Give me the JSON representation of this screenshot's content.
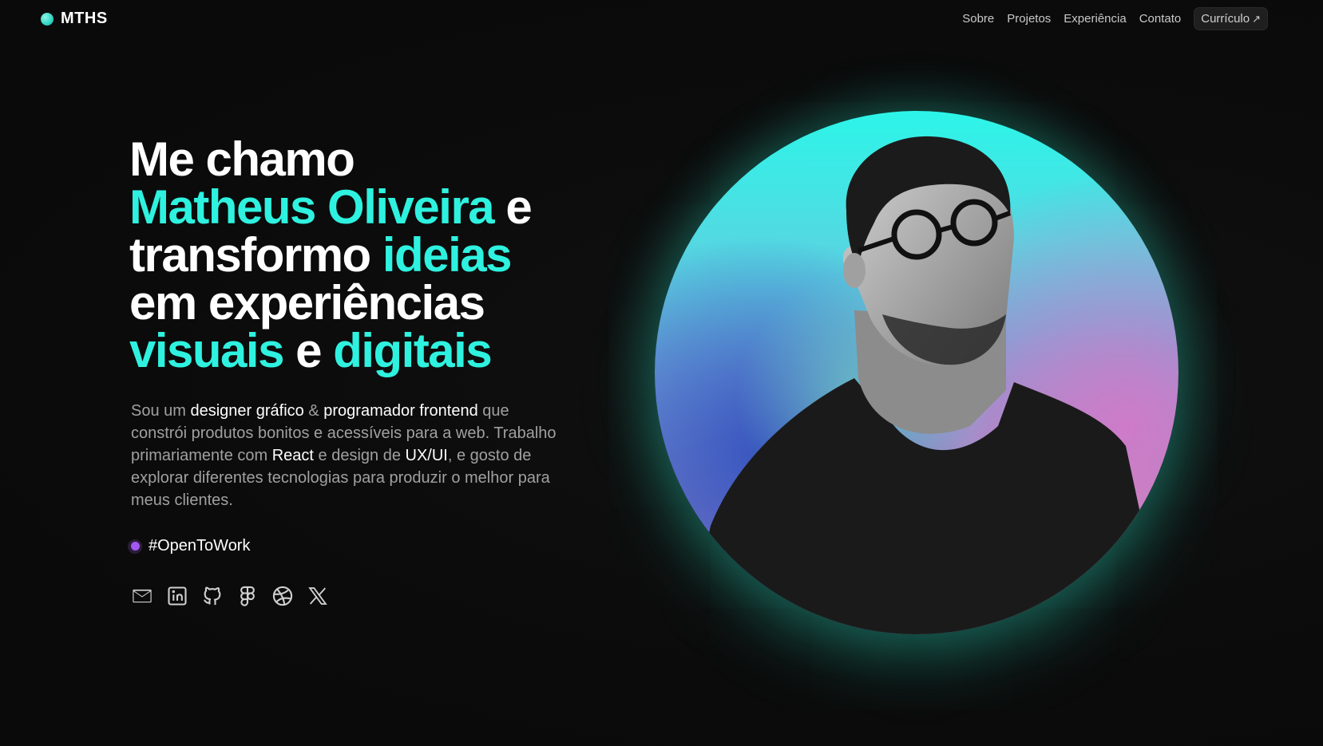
{
  "header": {
    "logo_text": "MTHS",
    "nav": [
      "Sobre",
      "Projetos",
      "Experiência",
      "Contato"
    ],
    "cv_label": "Currículo",
    "cv_icon": "arrow-up-right-icon"
  },
  "hero": {
    "line1": "Me chamo",
    "name": "Matheus Oliveira",
    "e1": "e",
    "transformo": "transformo",
    "ideias": "ideias",
    "line4": "em experiências",
    "visuais": "visuais",
    "e2": "e",
    "digitais": "digitais",
    "bio": {
      "p1": "Sou um ",
      "b1": "designer gráfico",
      "p2": " & ",
      "b2": "programador frontend",
      "p3": " que constrói produtos bonitos e acessíveis para a web. Trabalho primariamente com ",
      "b3": "React",
      "p4": " e design de ",
      "b4": "UX/UI",
      "p5": ", e gosto de explorar diferentes tecnologias para produzir o melhor para meus clientes."
    },
    "open_to_work": "#OpenToWork",
    "socials": [
      "mail-icon",
      "linkedin-icon",
      "github-icon",
      "figma-icon",
      "dribbble-icon",
      "x-icon"
    ]
  },
  "colors": {
    "accent": "#2ef2df",
    "background": "#0c0c0c",
    "status_dot": "#a258f0"
  }
}
